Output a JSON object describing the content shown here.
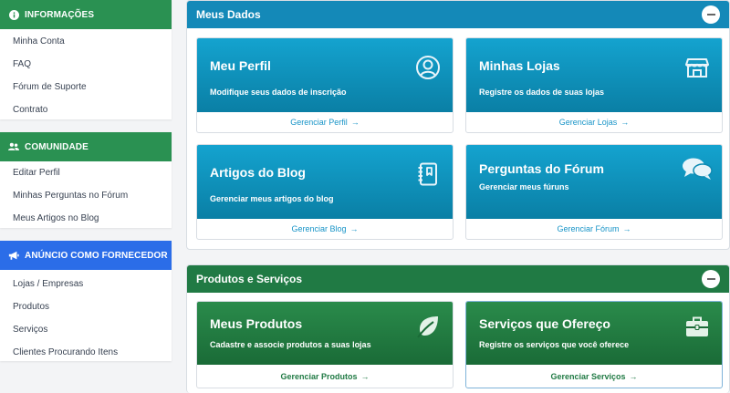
{
  "sidebar": {
    "sections": [
      {
        "title": "INFORMAÇÕES",
        "icon": "info-icon",
        "color": "#2a9152",
        "items": [
          "Minha Conta",
          "FAQ",
          "Fórum de Suporte",
          "Contrato"
        ]
      },
      {
        "title": "COMUNIDADE",
        "icon": "users-icon",
        "color": "#2a9152",
        "items": [
          "Editar Perfil",
          "Minhas Perguntas no Fórum",
          "Meus Artigos no Blog"
        ]
      },
      {
        "title": "ANÚNCIO COMO FORNECEDOR",
        "icon": "megaphone-icon",
        "color": "#2b6de8",
        "items": [
          "Lojas / Empresas",
          "Produtos",
          "Serviços",
          "Clientes Procurando Itens"
        ]
      }
    ]
  },
  "panels": {
    "meus_dados": {
      "title": "Meus Dados",
      "color": "#1489b8",
      "cards": [
        {
          "title": "Meu Perfil",
          "desc": "Modifique seus dados de inscrição",
          "link": "Gerenciar Perfil",
          "icon": "user-circle-icon"
        },
        {
          "title": "Minhas Lojas",
          "desc": "Registre os dados de suas lojas",
          "link": "Gerenciar Lojas",
          "icon": "store-icon"
        },
        {
          "title": "Artigos do Blog",
          "desc": "Gerenciar meus artigos do blog",
          "link": "Gerenciar Blog",
          "icon": "notebook-icon"
        },
        {
          "title": "Perguntas do Fórum",
          "desc": "Gerenciar meus fúruns",
          "link": "Gerenciar Fórum",
          "icon": "chat-bubbles-icon"
        }
      ]
    },
    "produtos_servicos": {
      "title": "Produtos e Serviços",
      "color": "#207a44",
      "cards": [
        {
          "title": "Meus Produtos",
          "desc": "Cadastre e associe produtos a suas lojas",
          "link": "Gerenciar Produtos",
          "icon": "leaf-icon"
        },
        {
          "title": "Serviços que Ofereço",
          "desc": "Registre os serviços que você oferece",
          "link": "Gerenciar Serviços",
          "icon": "briefcase-icon"
        }
      ]
    }
  },
  "link_arrow": "→"
}
